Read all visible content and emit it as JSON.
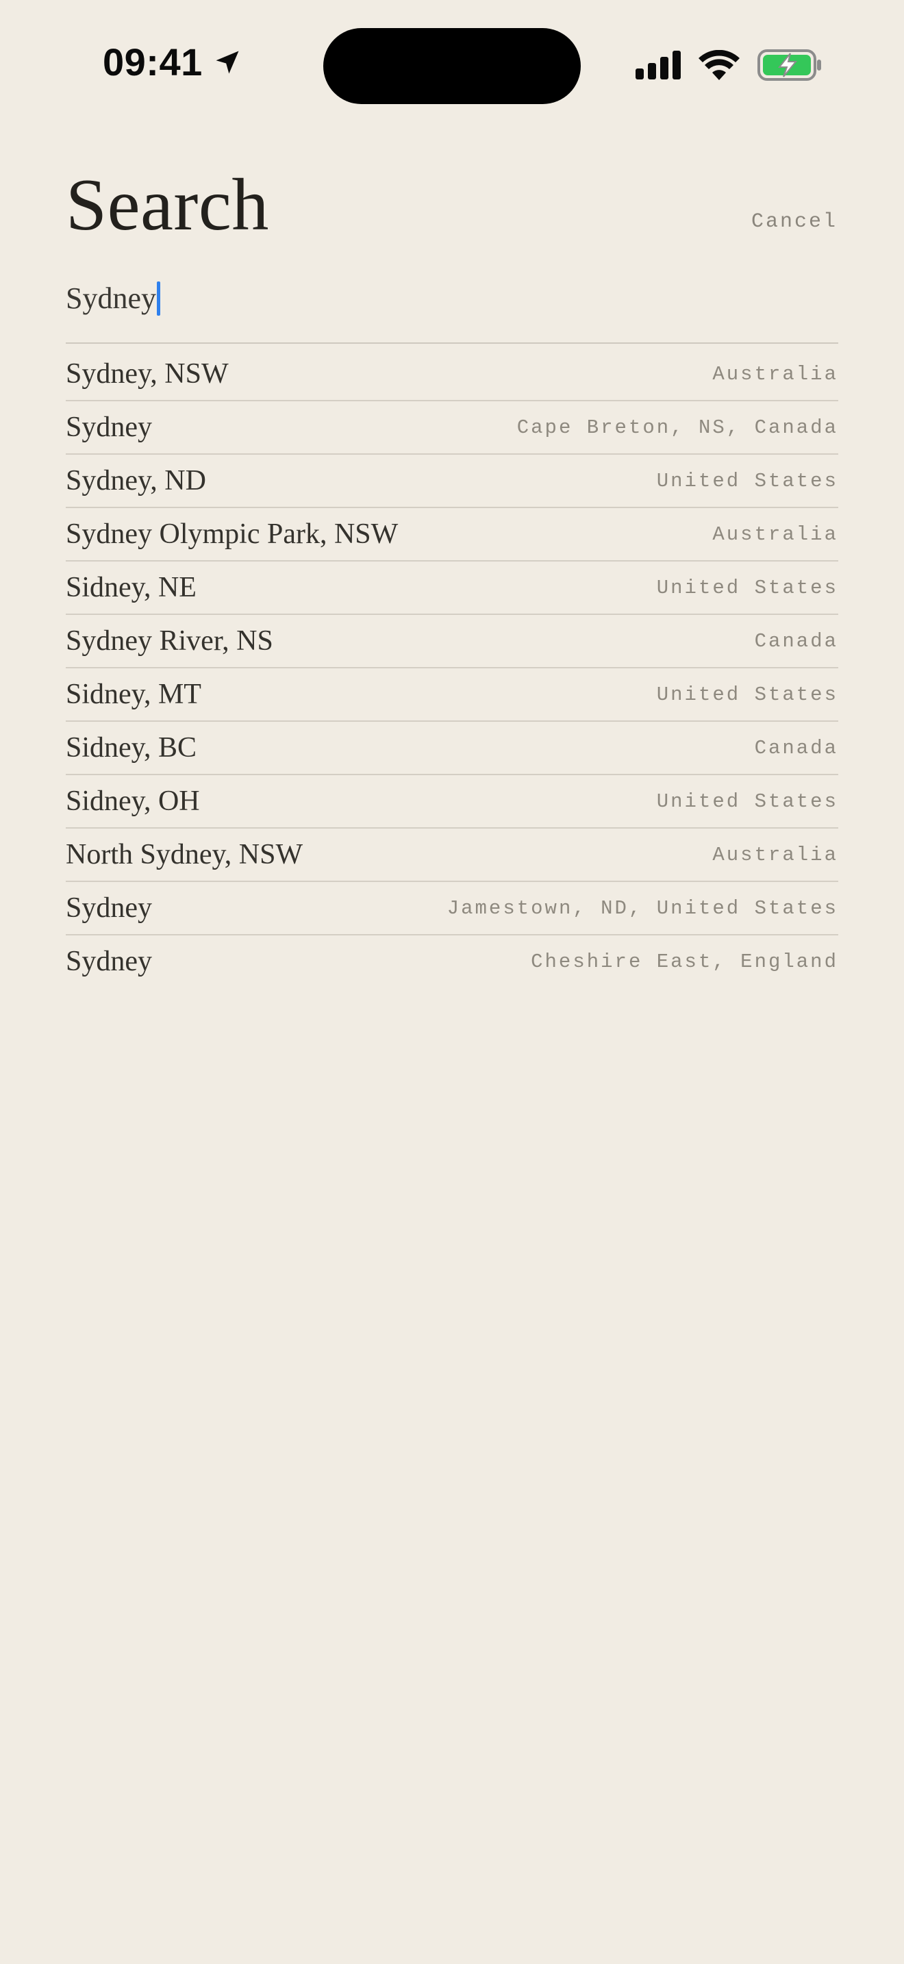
{
  "status_bar": {
    "time": "09:41",
    "icons": [
      "location-arrow-icon",
      "cellular-signal-icon",
      "wifi-icon",
      "battery-charging-icon"
    ],
    "battery_color": "#34c759"
  },
  "header": {
    "title": "Search",
    "cancel_label": "Cancel"
  },
  "search": {
    "value": "Sydney",
    "caret_color": "#2f80ed"
  },
  "results": [
    {
      "name": "Sydney, NSW",
      "region": "Australia"
    },
    {
      "name": "Sydney",
      "region": "Cape Breton, NS, Canada"
    },
    {
      "name": "Sydney, ND",
      "region": "United States"
    },
    {
      "name": "Sydney Olympic Park, NSW",
      "region": "Australia"
    },
    {
      "name": "Sidney, NE",
      "region": "United States"
    },
    {
      "name": "Sydney River, NS",
      "region": "Canada"
    },
    {
      "name": "Sidney, MT",
      "region": "United States"
    },
    {
      "name": "Sidney, BC",
      "region": "Canada"
    },
    {
      "name": "Sidney, OH",
      "region": "United States"
    },
    {
      "name": "North Sydney, NSW",
      "region": "Australia"
    },
    {
      "name": "Sydney",
      "region": "Jamestown, ND, United States"
    },
    {
      "name": "Sydney",
      "region": "Cheshire East, England"
    }
  ]
}
